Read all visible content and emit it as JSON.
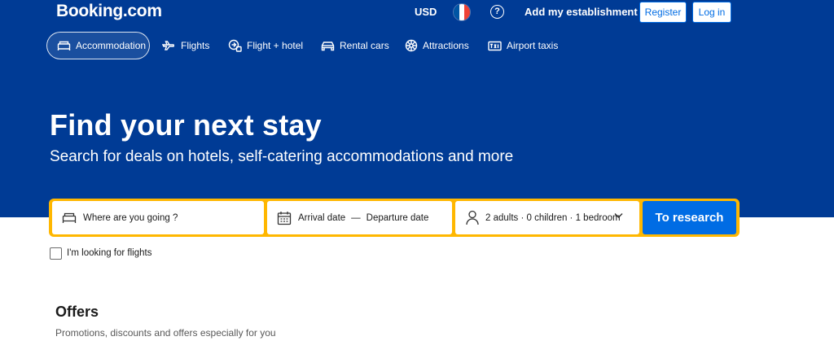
{
  "header": {
    "logo": "Booking.com",
    "currency": "USD",
    "language_flag": "france-flag",
    "help_icon": "question-circle-icon",
    "add_establishment": "Add my establishment",
    "register": "Register",
    "login": "Log in"
  },
  "nav": {
    "items": [
      {
        "label": "Accommodation",
        "icon": "bed-icon",
        "active": true
      },
      {
        "label": "Flights",
        "icon": "plane-icon"
      },
      {
        "label": "Flight + hotel",
        "icon": "plane-hotel-icon"
      },
      {
        "label": "Rental cars",
        "icon": "car-icon"
      },
      {
        "label": "Attractions",
        "icon": "attractions-icon"
      },
      {
        "label": "Airport taxis",
        "icon": "taxi-icon"
      }
    ]
  },
  "hero": {
    "title": "Find your next stay",
    "subtitle": "Search for deals on hotels, self-catering accommodations and more"
  },
  "search": {
    "destination_placeholder": "Where are you going ?",
    "arrival": "Arrival date",
    "separator": "—",
    "departure": "Departure date",
    "guests": "2 adults · 0 children · 1 bedroom",
    "submit": "To research",
    "flights_checkbox": "I'm looking for flights"
  },
  "offers": {
    "title": "Offers",
    "subtitle": "Promotions, discounts and offers especially for you"
  },
  "colors": {
    "brand_blue": "#003b95",
    "accent_blue": "#006ce4",
    "search_border": "#ffb700"
  }
}
